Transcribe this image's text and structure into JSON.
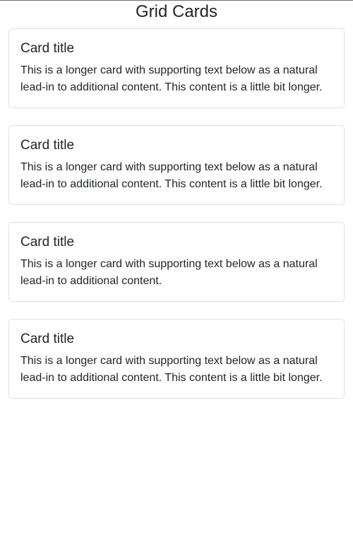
{
  "page": {
    "title": "Grid Cards"
  },
  "cards": [
    {
      "title": "Card title",
      "text": "This is a longer card with supporting text below as a natural lead-in to additional content. This content is a little bit longer."
    },
    {
      "title": "Card title",
      "text": "This is a longer card with supporting text below as a natural lead-in to additional content. This content is a little bit longer."
    },
    {
      "title": "Card title",
      "text": "This is a longer card with supporting text below as a natural lead-in to additional content."
    },
    {
      "title": "Card title",
      "text": "This is a longer card with supporting text below as a natural lead-in to additional content. This content is a little bit longer."
    }
  ],
  "colors": {
    "text": "#212529",
    "card_border": "#dfe1e3",
    "background": "#ffffff"
  }
}
